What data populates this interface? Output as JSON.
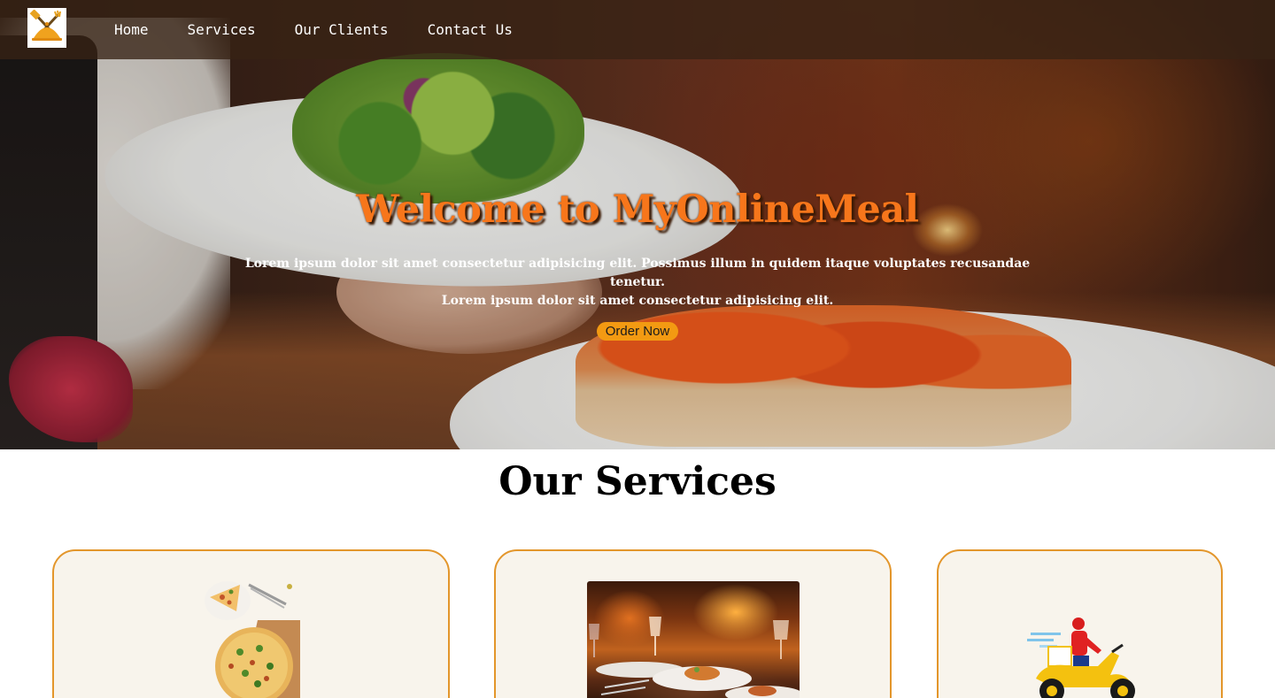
{
  "nav": {
    "links": [
      "Home",
      "Services",
      "Our Clients",
      "Contact Us"
    ]
  },
  "hero": {
    "title": "Welcome to MyOnlineMeal",
    "subtitle_line1": "Lorem ipsum dolor sit amet consectetur adipisicing elit. Possimus illum in quidem itaque voluptates recusandae tenetur.",
    "subtitle_line2": "Lorem ipsum dolor sit amet consectetur adipisicing elit.",
    "cta_label": "Order Now"
  },
  "services": {
    "heading": "Our Services",
    "cards": [
      {
        "image": "pizza-image"
      },
      {
        "image": "restaurant-dining-image"
      },
      {
        "image": "delivery-scooter-image"
      }
    ]
  },
  "colors": {
    "accent": "#f7761b",
    "button": "#f39a12",
    "card_border": "#e3962b",
    "card_bg": "#f8f4ec",
    "navbar_bg": "#37231499"
  }
}
